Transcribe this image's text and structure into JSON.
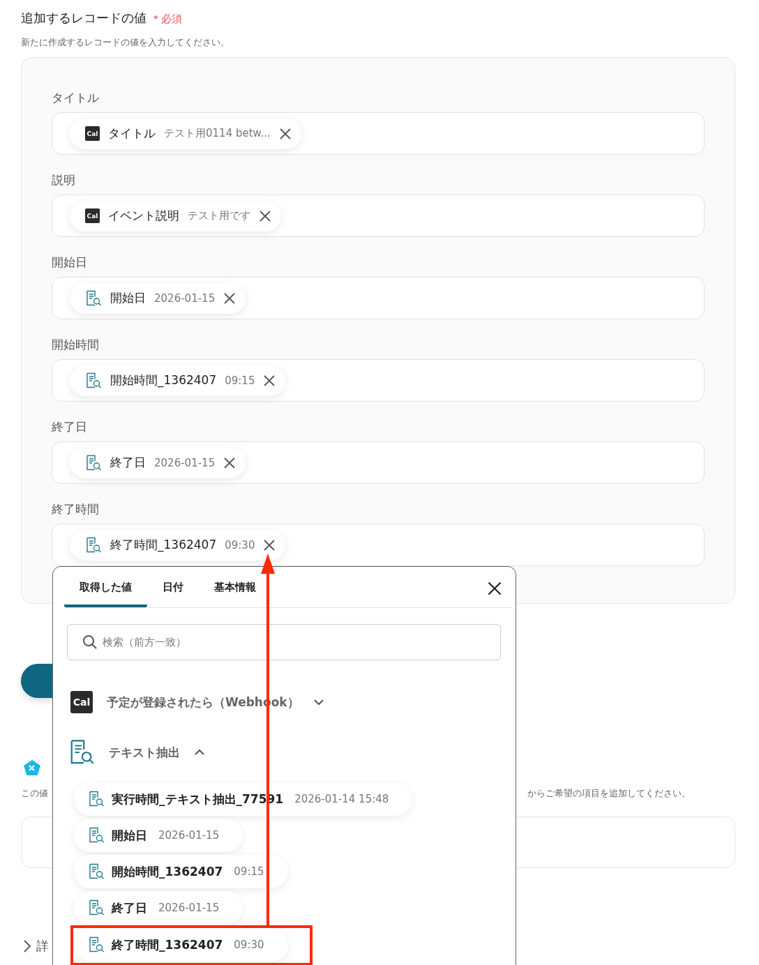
{
  "section": {
    "title": "追加するレコードの値",
    "required_mark": "＊",
    "required_label": "必須",
    "description": "新たに作成するレコードの値を入力してください。"
  },
  "fields": [
    {
      "label": "タイトル",
      "chip": {
        "kind": "cal",
        "logo": "Cal",
        "name": "タイトル",
        "value": "テスト用0114 betw..."
      }
    },
    {
      "label": "説明",
      "chip": {
        "kind": "cal",
        "logo": "Cal",
        "name": "イベント説明",
        "value": "テスト用です"
      }
    },
    {
      "label": "開始日",
      "chip": {
        "kind": "extract",
        "name": "開始日",
        "value": "2026-01-15"
      }
    },
    {
      "label": "開始時間",
      "chip": {
        "kind": "extract",
        "name": "開始時間_1362407",
        "value": "09:15"
      }
    },
    {
      "label": "終了日",
      "chip": {
        "kind": "extract",
        "name": "終了日",
        "value": "2026-01-15"
      }
    },
    {
      "label": "終了時間",
      "chip": {
        "kind": "extract",
        "name": "終了時間_1362407",
        "value": "09:30"
      }
    }
  ],
  "next_section": {
    "description_start": "この値",
    "description_end": "からご希望の項目を追加してください。"
  },
  "details": {
    "label": "詳"
  },
  "picker": {
    "tabs": [
      {
        "label": "取得した値",
        "selected": true
      },
      {
        "label": "日付",
        "selected": false
      },
      {
        "label": "基本情報",
        "selected": false
      }
    ],
    "search": {
      "placeholder": "検索（前方一致）"
    },
    "groups": [
      {
        "kind": "cal",
        "logo": "Cal",
        "title": "予定が登録されたら（Webhook）",
        "expanded": false
      },
      {
        "kind": "extract",
        "title": "テキスト抽出",
        "expanded": true,
        "items": [
          {
            "name": "実行時間_テキスト抽出_77591",
            "value": "2026-01-14 15:48",
            "highlighted": false
          },
          {
            "name": "開始日",
            "value": "2026-01-15",
            "highlighted": false
          },
          {
            "name": "開始時間_1362407",
            "value": "09:15",
            "highlighted": false
          },
          {
            "name": "終了日",
            "value": "2026-01-15",
            "highlighted": false
          },
          {
            "name": "終了時間_1362407",
            "value": "09:30",
            "highlighted": true
          }
        ]
      }
    ]
  }
}
